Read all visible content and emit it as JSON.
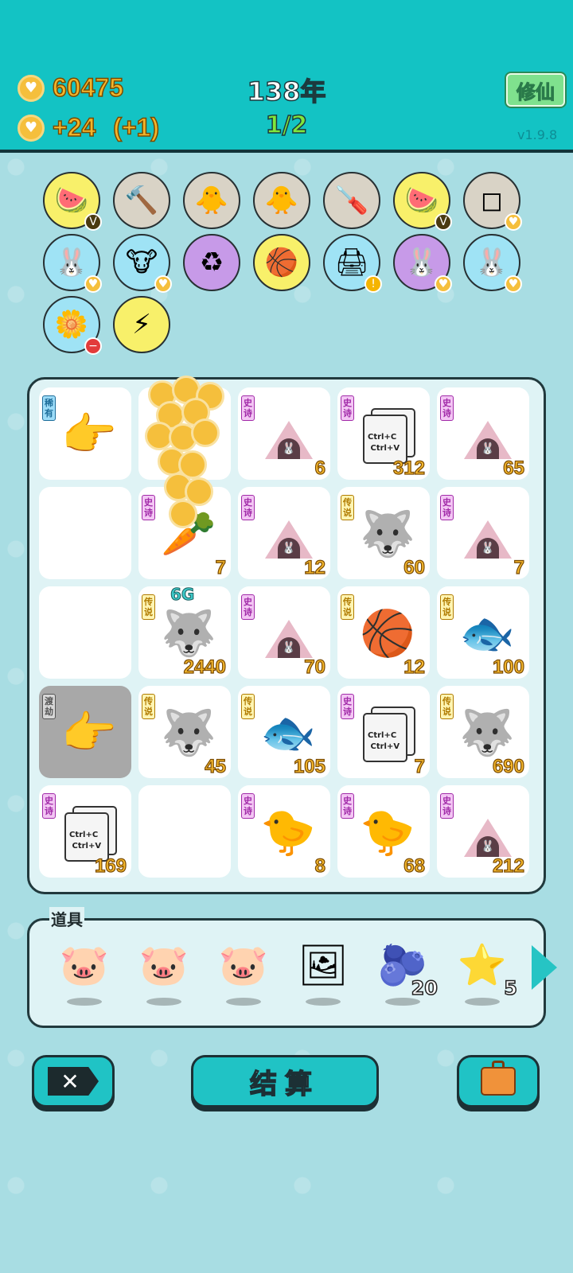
{
  "header": {
    "coins": "60475",
    "income": "+24",
    "income_bonus": "(+1)",
    "year": "138年",
    "wave": "1/2",
    "cultivate_label": "修仙",
    "version": "v1.9.8"
  },
  "relics": [
    {
      "name": "fruit-basket-icon",
      "glyph": "🍉",
      "bg": "#f8f06a",
      "badge": "V"
    },
    {
      "name": "hammer-icon",
      "glyph": "🔨",
      "bg": "#d9d3c6",
      "badge": ""
    },
    {
      "name": "chick-egg-icon",
      "glyph": "🐥",
      "bg": "#d9d3c6",
      "badge": ""
    },
    {
      "name": "chick-egg-icon",
      "glyph": "🐥",
      "bg": "#d9d3c6",
      "badge": ""
    },
    {
      "name": "screwdriver-icon",
      "glyph": "🪛",
      "bg": "#d9d3c6",
      "badge": ""
    },
    {
      "name": "fruit-basket-icon",
      "glyph": "🍉",
      "bg": "#f8f06a",
      "badge": "V"
    },
    {
      "name": "sugar-cubes-icon",
      "glyph": "◻",
      "bg": "#d9d3c6",
      "badge": "♥"
    },
    {
      "name": "rabbit-icon",
      "glyph": "🐰",
      "bg": "#9fe3f5",
      "badge": "♥"
    },
    {
      "name": "cow-pair-icon",
      "glyph": "🐮",
      "bg": "#9fe3f5",
      "badge": "♥"
    },
    {
      "name": "recycle-icon",
      "glyph": "♻",
      "bg": "#c79ae8",
      "badge": ""
    },
    {
      "name": "basketballs-icon",
      "glyph": "🏀",
      "bg": "#f8f06a",
      "badge": ""
    },
    {
      "name": "printer-icon",
      "glyph": "🖨",
      "bg": "#9fe3f5",
      "badge": "!"
    },
    {
      "name": "rabbit-icon",
      "glyph": "🐰",
      "bg": "#c79ae8",
      "badge": "♥"
    },
    {
      "name": "rabbit-icon",
      "glyph": "🐰",
      "bg": "#9fe3f5",
      "badge": "♥"
    },
    {
      "name": "flower-pot-icon",
      "glyph": "🌼",
      "bg": "#9fe3f5",
      "badge": "−"
    },
    {
      "name": "lightning-icon",
      "glyph": "⚡",
      "bg": "#f8f06a",
      "badge": ""
    }
  ],
  "board": [
    {
      "tag": "稀有",
      "tagType": "rare",
      "icon": "pointing-hand-brown-icon",
      "glyph": "👉",
      "value": "",
      "top": ""
    },
    {
      "tag": "",
      "tagType": "",
      "icon": "coin-pile-icon",
      "glyph": "",
      "value": "",
      "top": ""
    },
    {
      "tag": "史诗",
      "tagType": "epic",
      "icon": "rabbit-tent-icon",
      "glyph": "tent",
      "value": "6",
      "top": ""
    },
    {
      "tag": "史诗",
      "tagType": "epic",
      "icon": "copy-paste-icon",
      "glyph": "copy",
      "value": "312",
      "top": ""
    },
    {
      "tag": "史诗",
      "tagType": "epic",
      "icon": "rabbit-tent-icon",
      "glyph": "tent",
      "value": "65",
      "top": ""
    },
    {
      "tag": "",
      "tagType": "",
      "icon": "",
      "glyph": "",
      "value": "",
      "top": ""
    },
    {
      "tag": "史诗",
      "tagType": "epic",
      "icon": "carrot-icon",
      "glyph": "🥕",
      "value": "7",
      "top": ""
    },
    {
      "tag": "史诗",
      "tagType": "epic",
      "icon": "rabbit-tent-icon",
      "glyph": "tent",
      "value": "12",
      "top": ""
    },
    {
      "tag": "传说",
      "tagType": "leg",
      "icon": "husky-king-icon",
      "glyph": "🐺",
      "value": "60",
      "top": ""
    },
    {
      "tag": "史诗",
      "tagType": "epic",
      "icon": "rabbit-tent-icon",
      "glyph": "tent",
      "value": "7",
      "top": ""
    },
    {
      "tag": "",
      "tagType": "",
      "icon": "",
      "glyph": "",
      "value": "",
      "top": ""
    },
    {
      "tag": "传说",
      "tagType": "leg",
      "icon": "husky-king-icon",
      "glyph": "🐺",
      "value": "2440",
      "top": "6G"
    },
    {
      "tag": "史诗",
      "tagType": "epic",
      "icon": "rabbit-tent-basketball-icon",
      "glyph": "tent",
      "value": "70",
      "top": ""
    },
    {
      "tag": "传说",
      "tagType": "leg",
      "icon": "hand-basketball-icon",
      "glyph": "🏀",
      "value": "12",
      "top": ""
    },
    {
      "tag": "传说",
      "tagType": "leg",
      "icon": "koi-fish-icon",
      "glyph": "🐟",
      "value": "100",
      "top": ""
    },
    {
      "tag": "渡劫",
      "tagType": "dis",
      "icon": "pointing-hand-yellow-icon",
      "glyph": "👉",
      "value": "",
      "top": ""
    },
    {
      "tag": "传说",
      "tagType": "leg",
      "icon": "husky-king-icon",
      "glyph": "🐺",
      "value": "45",
      "top": ""
    },
    {
      "tag": "传说",
      "tagType": "leg",
      "icon": "koi-basketball-icon",
      "glyph": "🐟",
      "value": "105",
      "top": ""
    },
    {
      "tag": "史诗",
      "tagType": "epic",
      "icon": "copy-paste-icon",
      "glyph": "copy",
      "value": "7",
      "top": ""
    },
    {
      "tag": "传说",
      "tagType": "leg",
      "icon": "husky-king-icon",
      "glyph": "🐺",
      "value": "690",
      "top": ""
    },
    {
      "tag": "史诗",
      "tagType": "epic",
      "icon": "copy-paste-icon",
      "glyph": "copy",
      "value": "169",
      "top": ""
    },
    {
      "tag": "",
      "tagType": "",
      "icon": "",
      "glyph": "",
      "value": "",
      "top": ""
    },
    {
      "tag": "史诗",
      "tagType": "epic",
      "icon": "chicken-idol-icon",
      "glyph": "🐤",
      "value": "8",
      "top": ""
    },
    {
      "tag": "史诗",
      "tagType": "epic",
      "icon": "chicken-idol-icon",
      "glyph": "🐤",
      "value": "68",
      "top": ""
    },
    {
      "tag": "史诗",
      "tagType": "epic",
      "icon": "rabbit-tent-icon",
      "glyph": "tent",
      "value": "212",
      "top": ""
    }
  ],
  "copy_text": [
    "Ctrl+C",
    "Ctrl+V"
  ],
  "items": {
    "title": "道具",
    "list": [
      {
        "name": "piggy-bank-icon",
        "glyph": "🐷",
        "count": ""
      },
      {
        "name": "piggy-bank-icon",
        "glyph": "🐷",
        "count": ""
      },
      {
        "name": "piggy-bank-icon",
        "glyph": "🐷",
        "count": ""
      },
      {
        "name": "picture-frame-icon",
        "glyph": "🖼",
        "count": ""
      },
      {
        "name": "blueberry-icon",
        "glyph": "🫐",
        "count": "20"
      },
      {
        "name": "star-icon",
        "glyph": "⭐",
        "count": "5"
      }
    ]
  },
  "buttons": {
    "close": "✕",
    "settle": "结算",
    "bag": ""
  }
}
